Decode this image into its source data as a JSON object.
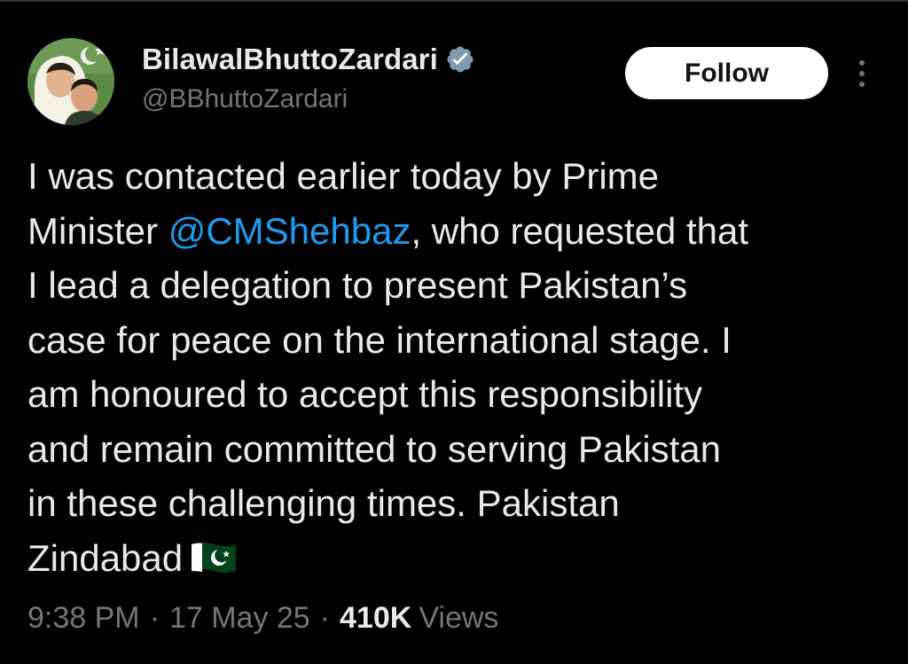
{
  "author": {
    "display_name": "BilawalBhuttoZardari",
    "handle": "@BBhuttoZardari",
    "verified": true,
    "verified_color": "#829aab"
  },
  "actions": {
    "follow_label": "Follow",
    "more_icon": "more-vertical-icon"
  },
  "tweet": {
    "lines": [
      {
        "text": "I was contacted earlier today by Prime"
      },
      {
        "before": "Minister ",
        "mention": "@CMShehbaz",
        "after": ", who requested that"
      },
      {
        "text": "I lead a delegation to present Pakistan’s"
      },
      {
        "text": "case for peace on the international stage. I"
      },
      {
        "text": "am honoured to accept this responsibility"
      },
      {
        "text": "and remain committed to serving Pakistan"
      },
      {
        "text": "in these challenging times. Pakistan"
      },
      {
        "text": "Zindabad",
        "emoji": "pakistan-flag-emoji"
      }
    ],
    "mention_color": "#1d9bf0"
  },
  "meta": {
    "time": "9:38 PM",
    "separator": "·",
    "date": "17 May 25",
    "views_count": "410K",
    "views_label": "Views"
  },
  "colors": {
    "background": "#000000",
    "text_primary": "#e7e9ea",
    "text_secondary": "#71767b",
    "button_bg": "#ffffff",
    "button_text": "#0f1419"
  }
}
